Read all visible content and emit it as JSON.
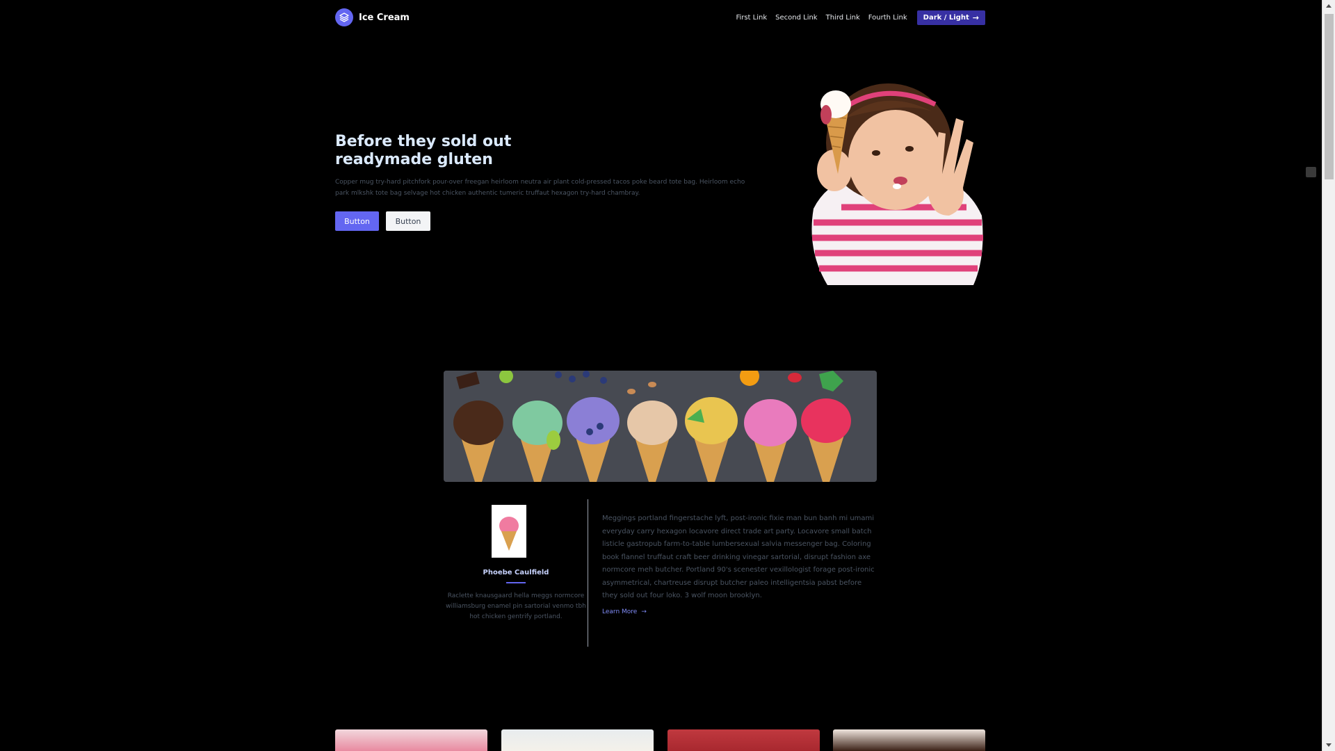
{
  "header": {
    "brand": "Ice Cream",
    "links": [
      "First Link",
      "Second Link",
      "Third Link",
      "Fourth Link"
    ],
    "cta": "Dark / Light"
  },
  "hero": {
    "title_line1": "Before they sold out",
    "title_line2": "readymade gluten",
    "description": "Copper mug try-hard pitchfork pour-over freegan heirloom neutra air plant cold-pressed tacos poke beard tote bag. Heirloom echo park mlkshk tote bag selvage hot chicken authentic tumeric truffaut hexagon try-hard chambray.",
    "primary_button": "Button",
    "secondary_button": "Button"
  },
  "profile": {
    "name": "Phoebe Caulfield",
    "bio": "Raclette knausgaard hella meggs normcore williamsburg enamel pin sartorial venmo tbh hot chicken gentrify portland."
  },
  "article": {
    "text": "Meggings portland fingerstache lyft, post-ironic fixie man bun banh mi umami everyday carry hexagon locavore direct trade art party. Locavore small batch listicle gastropub farm-to-table lumbersexual salvia messenger bag. Coloring book flannel truffaut craft beer drinking vinegar sartorial, disrupt fashion axe normcore meh butcher. Portland 90's scenester vexillologist forage post-ironic asymmetrical, chartreuse disrupt butcher paleo intelligentsia pabst before they sold out four loko. 3 wolf moon brooklyn.",
    "link": "Learn More"
  },
  "colors": {
    "accent": "#6366f1",
    "background": "#000000",
    "cta": "#3730a3"
  }
}
